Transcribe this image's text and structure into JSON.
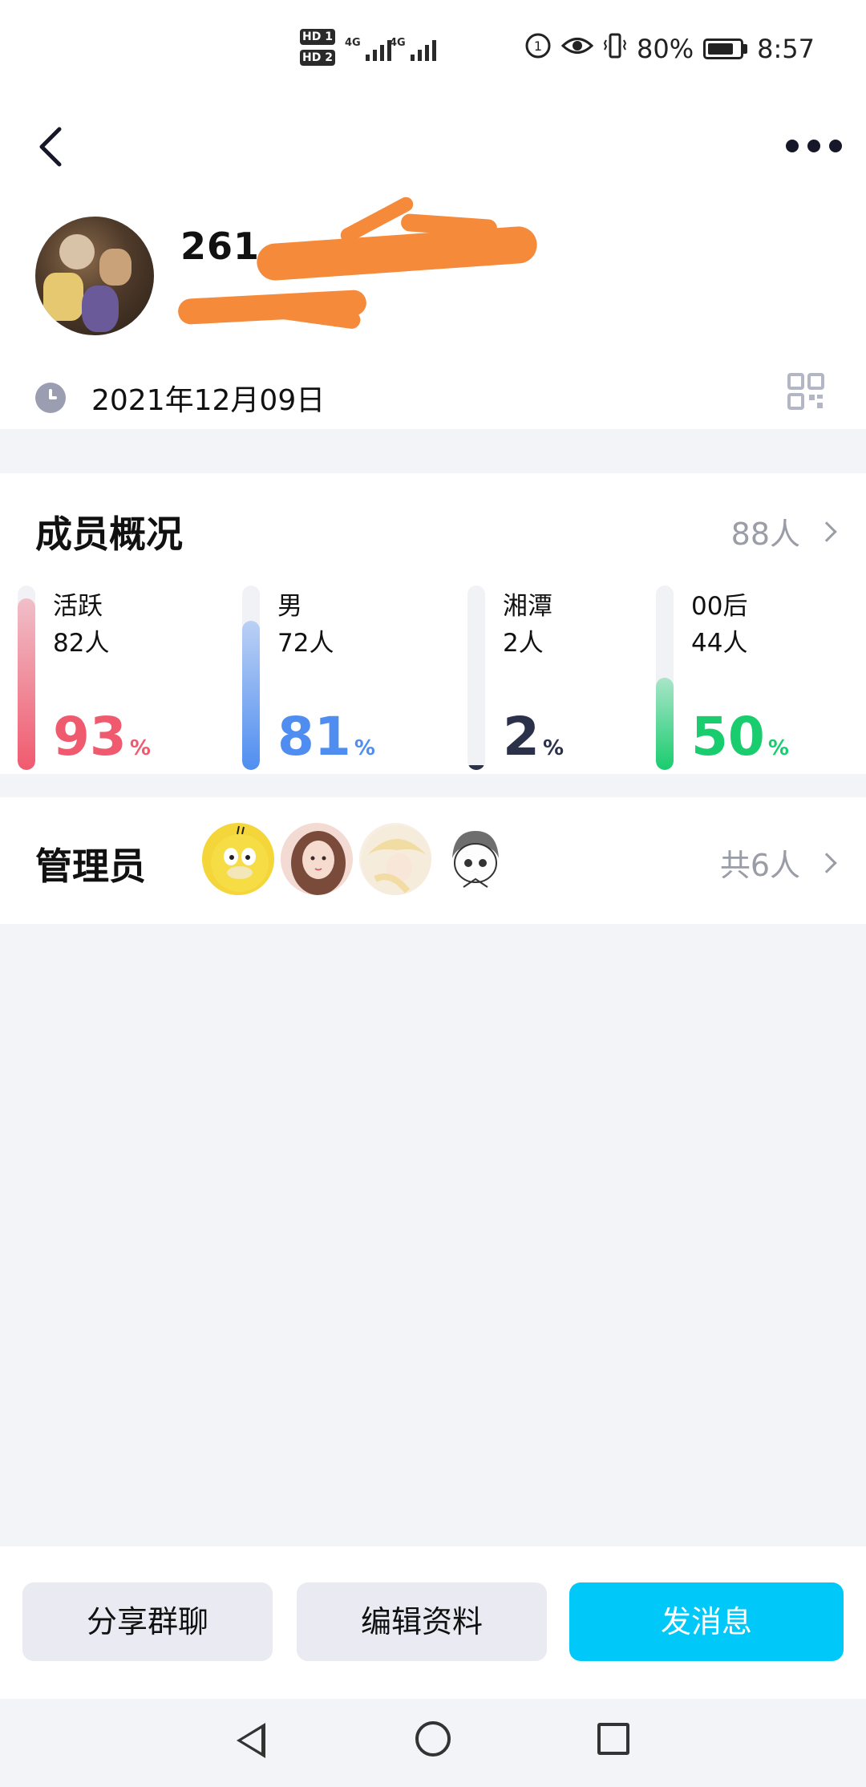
{
  "status_bar": {
    "sim1_badge": "HD 1",
    "sim2_badge": "HD 2",
    "network1": "4G",
    "network2": "4G",
    "battery_percent": "80%",
    "time": "8:57"
  },
  "header": {
    "group_name": "261 ",
    "group_id": "",
    "created_date": "2021年12月09日"
  },
  "members": {
    "title": "成员概况",
    "total": "88人",
    "stats": [
      {
        "label": "活跃",
        "count": "82人",
        "percent": "93",
        "percent_unit": "%",
        "color": "#f05a6e",
        "fill": 0.93
      },
      {
        "label": "男",
        "count": "72人",
        "percent": "81",
        "percent_unit": "%",
        "color": "#4f8ef0",
        "fill": 0.81
      },
      {
        "label": "湘潭",
        "count": "2人",
        "percent": "2",
        "percent_unit": "%",
        "color": "#2a3148",
        "fill": 0.02
      },
      {
        "label": "00后",
        "count": "44人",
        "percent": "50",
        "percent_unit": "%",
        "color": "#19cc6e",
        "fill": 0.5
      }
    ]
  },
  "admins": {
    "title": "管理员",
    "total": "共6人",
    "avatars": [
      "psyduck-avatar",
      "girl-avatar",
      "blonde-avatar",
      "boy-avatar"
    ]
  },
  "actions": {
    "share_label": "分享群聊",
    "edit_label": "编辑资料",
    "message_label": "发消息"
  },
  "colors": {
    "primary": "#00c8f8",
    "background": "#f3f4f8"
  }
}
